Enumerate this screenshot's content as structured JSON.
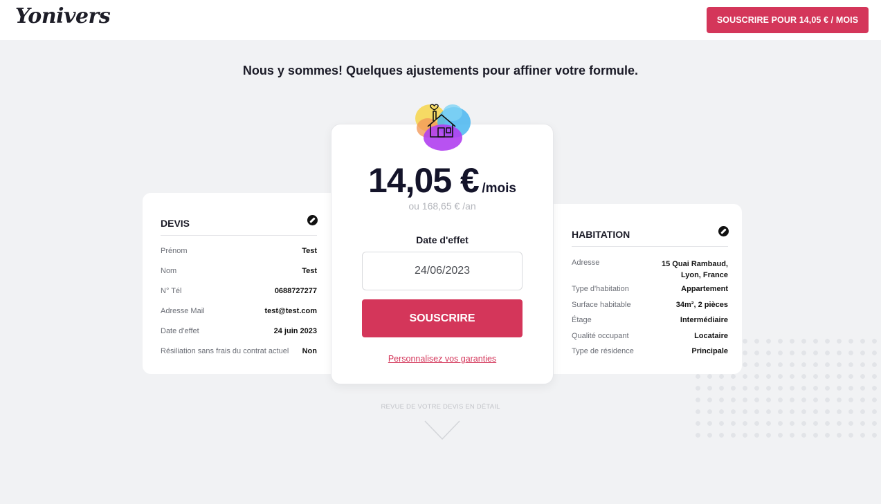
{
  "header": {
    "logo": "Yonivers",
    "cta_label": "SOUSCRIRE POUR 14,05 € / MOIS"
  },
  "headline": "Nous y sommes! Quelques ajustements pour affiner votre formule.",
  "devis": {
    "title": "DEVIS",
    "rows": [
      {
        "label": "Prénom",
        "value": "Test"
      },
      {
        "label": "Nom",
        "value": "Test"
      },
      {
        "label": "N° Tél",
        "value": "0688727277"
      },
      {
        "label": "Adresse Mail",
        "value": "test@test.com"
      },
      {
        "label": "Date d'effet",
        "value": "24 juin 2023"
      },
      {
        "label": "Résiliation sans frais du contrat actuel",
        "value": "Non"
      }
    ]
  },
  "pricing": {
    "monthly": "14,05 €",
    "monthly_unit": "/mois",
    "annual": "ou 168,65 € /an",
    "date_label": "Date d'effet",
    "date_value": "24/06/2023",
    "subscribe_label": "SOUSCRIRE",
    "customize_link": "Personnalisez vos garanties"
  },
  "habitation": {
    "title": "HABITATION",
    "rows": [
      {
        "label": "Adresse",
        "value_line1": "15 Quai Rambaud,",
        "value_line2": "Lyon, France"
      },
      {
        "label": "Type d'habitation",
        "value": "Appartement"
      },
      {
        "label": "Surface habitable",
        "value": "34m², 2 pièces"
      },
      {
        "label": "Étage",
        "value": "Intermédiaire"
      },
      {
        "label": "Qualité occupant",
        "value": "Locataire"
      },
      {
        "label": "Type de résidence",
        "value": "Principale"
      }
    ]
  },
  "review_label": "REVUE DE VOTRE DEVIS EN DÉTAIL",
  "colors": {
    "accent": "#d4365a",
    "background": "#f1f2f4",
    "text_dark": "#14142a"
  },
  "icons": {
    "edit": "pencil-circle-icon",
    "house": "house-heart-icon",
    "chevron": "chevron-down-icon"
  }
}
